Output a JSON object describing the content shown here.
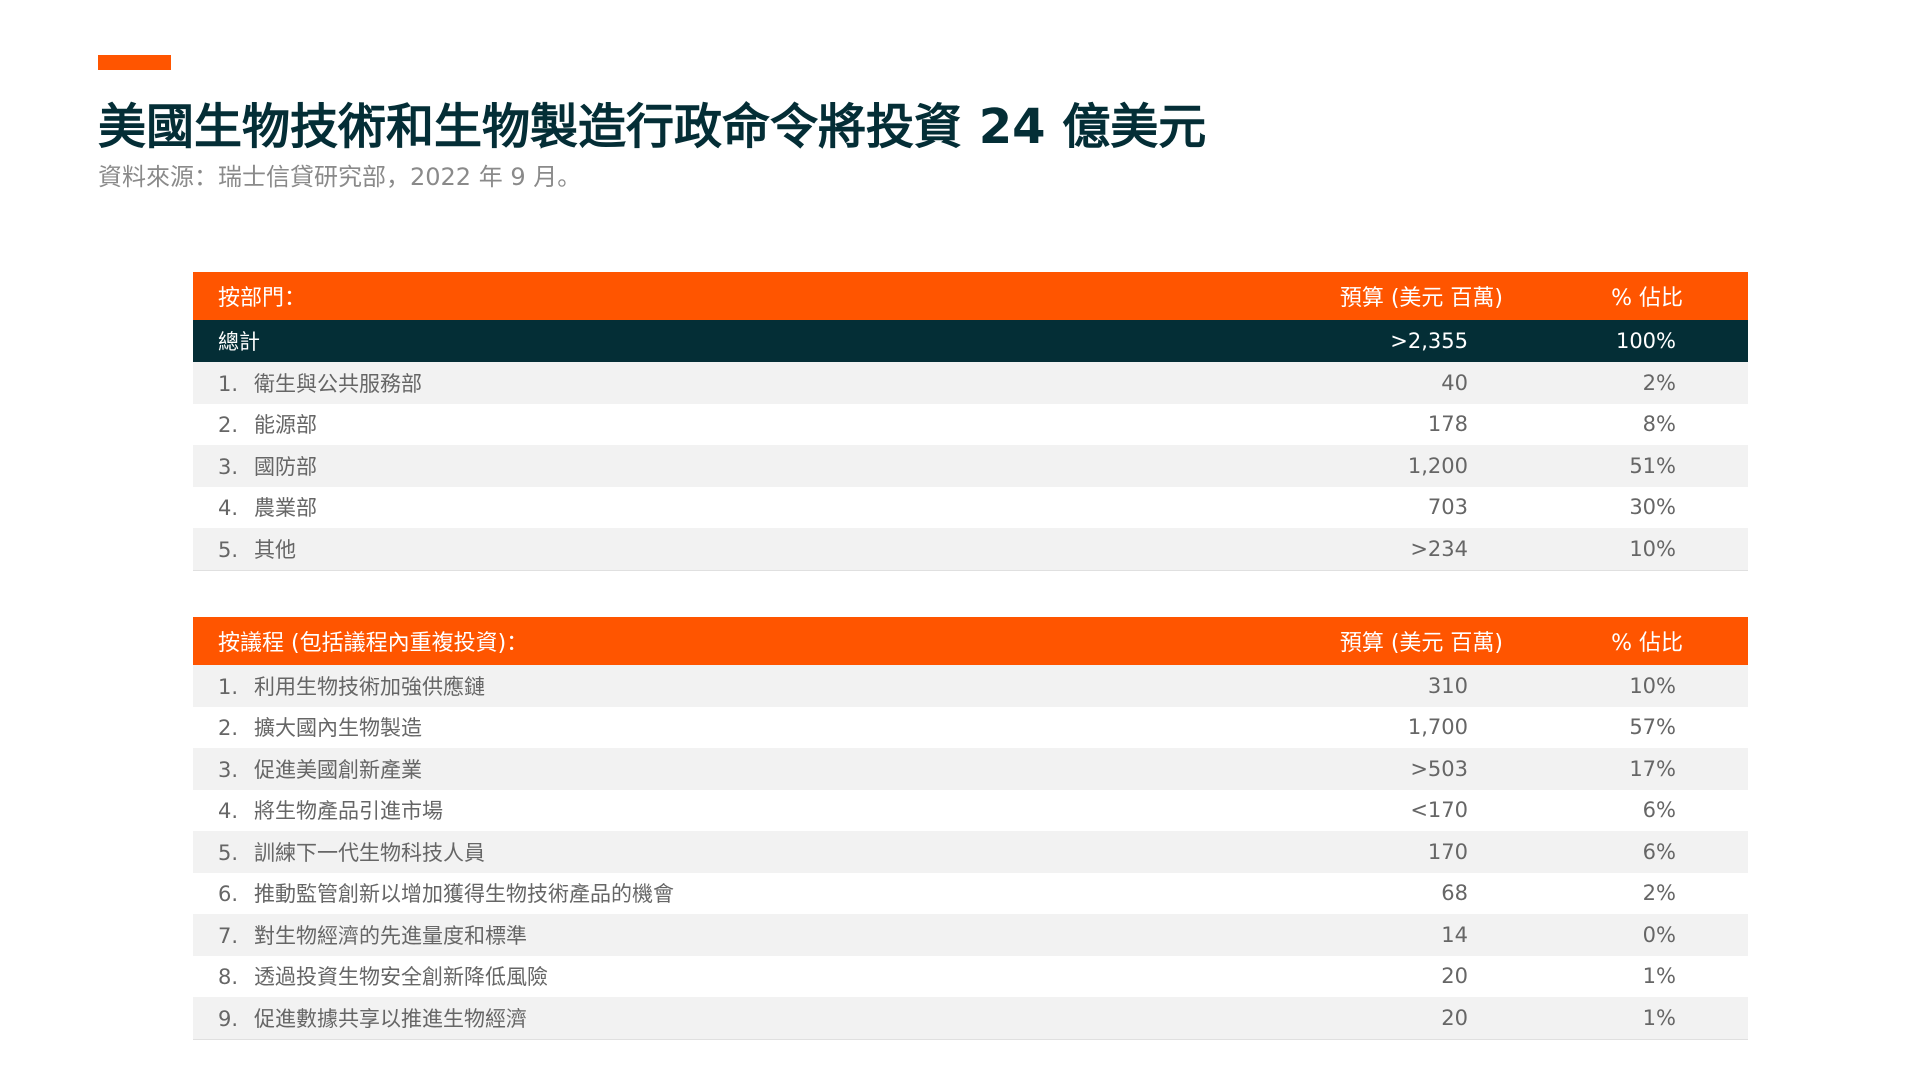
{
  "title": "美國生物技術和生物製造行政命令將投資 24 億美元",
  "source": "資料來源：瑞士信貸研究部，2022 年 9 月。",
  "colors": {
    "accent": "#FF5500",
    "dark": "#042E36",
    "row_alt": "#F2F2F2"
  },
  "table_department": {
    "headers": {
      "label": "按部門：",
      "budget": "預算 (美元 百萬)",
      "share": "% 佔比"
    },
    "total": {
      "label": "總計",
      "budget": ">2,355",
      "share": "100%"
    },
    "rows": [
      {
        "num": "1.",
        "label": "衛生與公共服務部",
        "budget": "40",
        "share": "2%"
      },
      {
        "num": "2.",
        "label": "能源部",
        "budget": "178",
        "share": "8%"
      },
      {
        "num": "3.",
        "label": "國防部",
        "budget": "1,200",
        "share": "51%"
      },
      {
        "num": "4.",
        "label": "農業部",
        "budget": "703",
        "share": "30%"
      },
      {
        "num": "5.",
        "label": "其他",
        "budget": ">234",
        "share": "10%"
      }
    ]
  },
  "table_agenda": {
    "headers": {
      "label": "按議程 (包括議程內重複投資)：",
      "budget": "預算 (美元 百萬)",
      "share": "% 佔比"
    },
    "rows": [
      {
        "num": "1.",
        "label": "利用生物技術加強供應鏈",
        "budget": "310",
        "share": "10%"
      },
      {
        "num": "2.",
        "label": "擴大國內生物製造",
        "budget": "1,700",
        "share": "57%"
      },
      {
        "num": "3.",
        "label": "促進美國創新產業",
        "budget": ">503",
        "share": "17%"
      },
      {
        "num": "4.",
        "label": "將生物產品引進市場",
        "budget": "<170",
        "share": "6%"
      },
      {
        "num": "5.",
        "label": "訓練下一代生物科技人員",
        "budget": "170",
        "share": "6%"
      },
      {
        "num": "6.",
        "label": "推動監管創新以增加獲得生物技術產品的機會",
        "budget": "68",
        "share": "2%"
      },
      {
        "num": "7.",
        "label": "對生物經濟的先進量度和標準",
        "budget": "14",
        "share": "0%"
      },
      {
        "num": "8.",
        "label": "透過投資生物安全創新降低風險",
        "budget": "20",
        "share": "1%"
      },
      {
        "num": "9.",
        "label": "促進數據共享以推進生物經濟",
        "budget": "20",
        "share": "1%"
      }
    ]
  }
}
